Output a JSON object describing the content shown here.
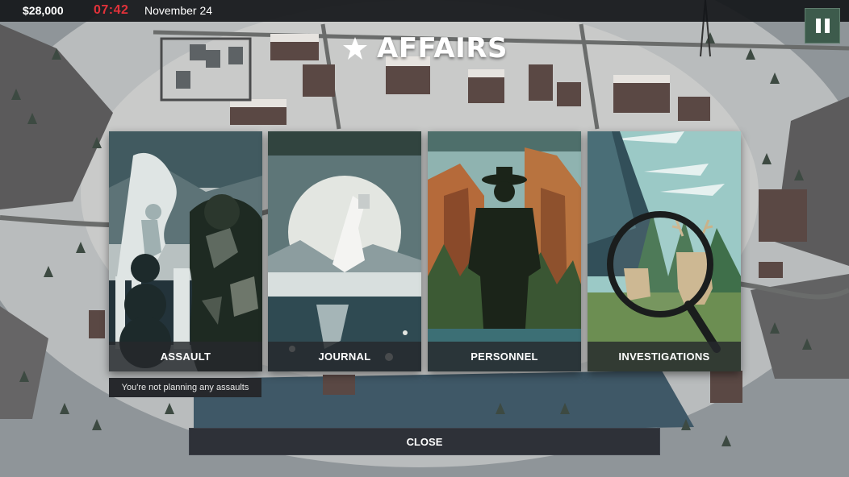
{
  "hud": {
    "money": "$28,000",
    "clock": "07:42",
    "date": "November 24"
  },
  "pause": {
    "icon": "pause-icon"
  },
  "title": {
    "icon": "star-icon",
    "text": "AFFAIRS"
  },
  "cards": [
    {
      "id": "assault",
      "label": "ASSAULT"
    },
    {
      "id": "journal",
      "label": "JOURNAL"
    },
    {
      "id": "personnel",
      "label": "PERSONNEL"
    },
    {
      "id": "investigations",
      "label": "INVESTIGATIONS"
    }
  ],
  "assault_note": "You're not planning any assaults",
  "close_button": "CLOSE",
  "colors": {
    "hud_bg": "#141619",
    "clock_red": "#e2323a",
    "pause_green": "#3d5b4c",
    "panel_dark": "#26282c"
  }
}
